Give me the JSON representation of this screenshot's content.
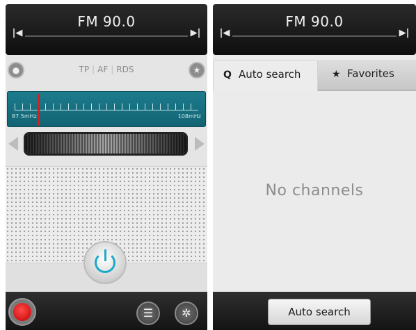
{
  "left_panel": {
    "frequency": "FM 90.0",
    "status": {
      "tp": "TP",
      "af": "AF",
      "rds": "RDS",
      "separator": "|"
    },
    "dial": {
      "min_label": "87.5mHz",
      "max_label": "108mHz"
    },
    "icons": {
      "prev": "skip-previous-icon",
      "next": "skip-next-icon",
      "profile": "person-circle-icon",
      "favorite": "star-circle-icon",
      "power": "power-icon",
      "record": "record-icon",
      "list": "list-icon",
      "settings": "gear-icon"
    },
    "glyphs": {
      "prev": "|◀",
      "next": "▶|",
      "profile": "●",
      "favorite": "★",
      "list": "☰",
      "settings": "✲"
    }
  },
  "right_panel": {
    "frequency": "FM 90.0",
    "tabs": [
      {
        "label": "Auto search",
        "icon": "search-icon",
        "glyph": "Q",
        "active": true
      },
      {
        "label": "Favorites",
        "icon": "star-icon",
        "glyph": "★",
        "active": false
      }
    ],
    "empty_message": "No channels",
    "auto_search_button": "Auto search"
  },
  "colors": {
    "accent": "#19a9c9",
    "dial": "#1c7c8c",
    "needle": "#d32020",
    "record": "#e31b1b"
  }
}
